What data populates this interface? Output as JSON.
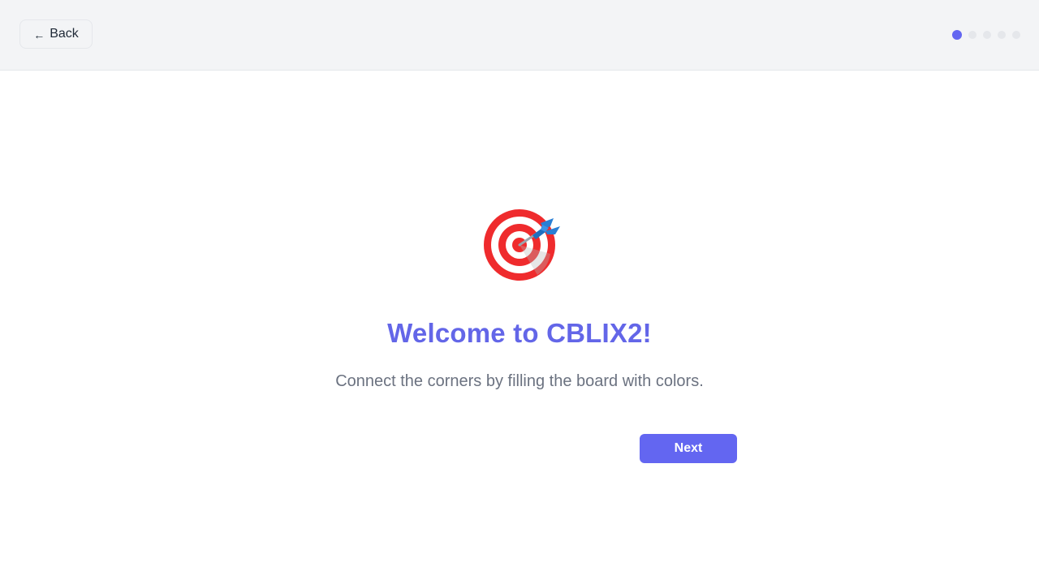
{
  "header": {
    "back_label": "Back",
    "back_arrow": "←",
    "progress": {
      "total_steps": 5,
      "current_step": 1
    }
  },
  "main": {
    "icon": "target-dart-icon",
    "title": "Welcome to CBLIX2!",
    "subtitle": "Connect the corners by filling the board with colors.",
    "next_label": "Next"
  },
  "colors": {
    "accent": "#6366f1",
    "title": "#6366e8",
    "header_bg": "#f3f4f6",
    "inactive_dot": "#e5e7eb",
    "subtitle": "#6b7280",
    "target_red": "#ef2b2d",
    "dart_blue": "#2a7fd4"
  }
}
